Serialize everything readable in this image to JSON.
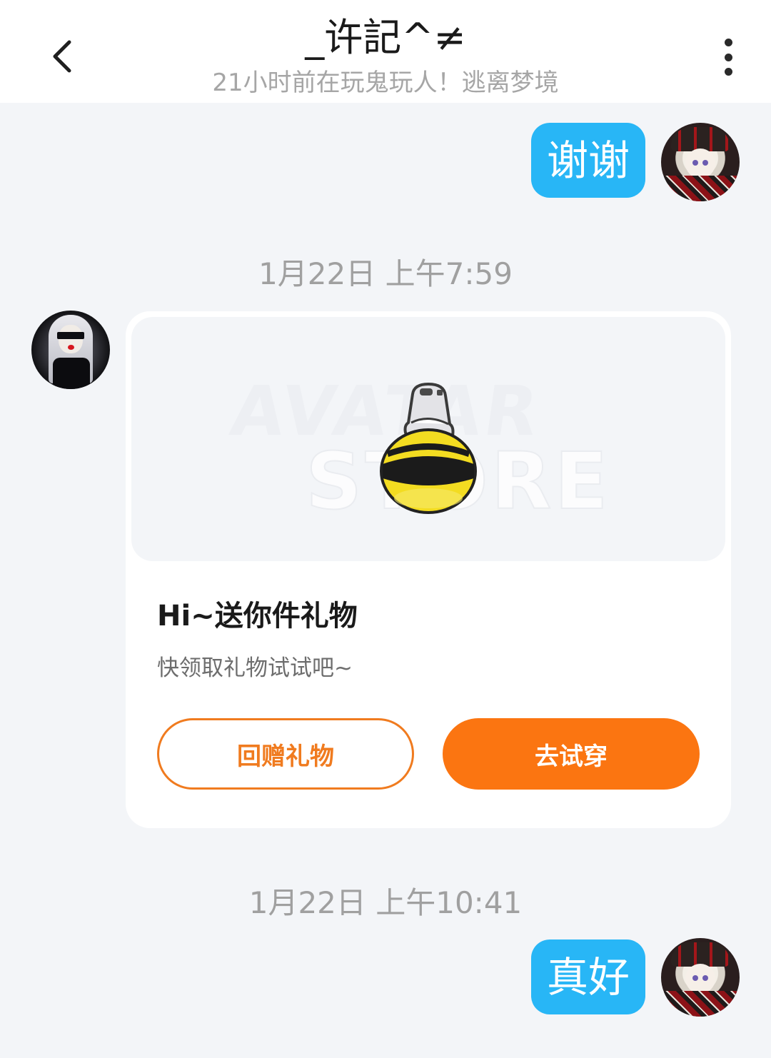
{
  "header": {
    "title": "_许記^≠",
    "subtitle": "21小时前在玩鬼玩人！逃离梦境"
  },
  "messages": {
    "msg1": {
      "sender": "me",
      "text": "谢谢"
    },
    "time1": "1月22日  上午7:59",
    "gift": {
      "sender": "other",
      "watermark_line1": "AVATAR",
      "watermark_line2": "STORE",
      "title": "Hi~送你件礼物",
      "description": "快领取礼物试试吧~",
      "return_button": "回赠礼物",
      "try_button": "去试穿"
    },
    "time2": "1月22日  上午10:41",
    "msg2": {
      "sender": "me",
      "text": "真好"
    }
  },
  "icons": {
    "back": "chevron-left-icon",
    "more": "more-vertical-icon"
  },
  "colors": {
    "bubble_me": "#28b6f6",
    "accent_orange": "#fb7511",
    "background": "#f3f5f8"
  }
}
